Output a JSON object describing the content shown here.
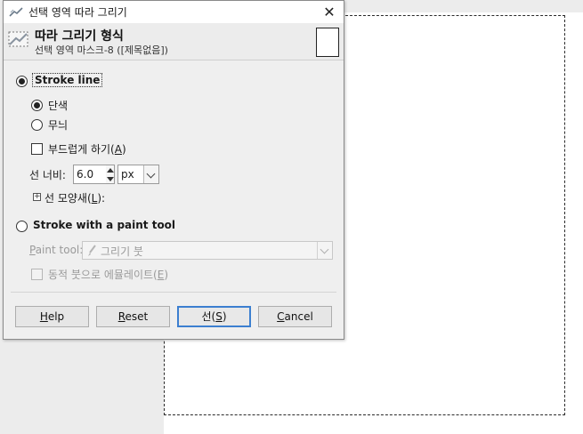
{
  "dialog": {
    "title": "선택 영역 따라 그리기",
    "close_glyph": "✕",
    "header_title": "따라 그리기 형식",
    "header_subtitle": "선택 영역 마스크-8 ([제목없음])"
  },
  "stroke_line": {
    "label": "Stroke line",
    "selected": true,
    "solid_label": "단색",
    "pattern_label": "무늬",
    "antialias_label_prefix": "부드럽게 하기(",
    "antialias_mnemonic": "A",
    "antialias_label_suffix": ")",
    "line_width_label": "선 너비:",
    "line_width_value": "6.0",
    "unit_value": "px",
    "line_style_prefix": "선 모양새(",
    "line_style_mnemonic": "L",
    "line_style_suffix": "):",
    "expander_glyph": "+"
  },
  "paint_tool": {
    "label": "Stroke with a paint tool",
    "selected": false,
    "tool_label_prefix": "P",
    "tool_label_rest": "aint tool:",
    "tool_value": "그리기 붓",
    "emulate_prefix": "동적 붓으로 에뮬레이트(",
    "emulate_mnemonic": "E",
    "emulate_suffix": ")"
  },
  "buttons": {
    "help_mnemonic": "H",
    "help_rest": "elp",
    "reset_mnemonic": "R",
    "reset_rest": "eset",
    "stroke_prefix": "선(",
    "stroke_mnemonic": "S",
    "stroke_suffix": ")",
    "cancel_mnemonic": "C",
    "cancel_rest": "ancel"
  },
  "colors": {
    "default_button_border": "#3c7fd0",
    "dialog_bg": "#efefef",
    "canvas_bg": "#ffffff"
  }
}
